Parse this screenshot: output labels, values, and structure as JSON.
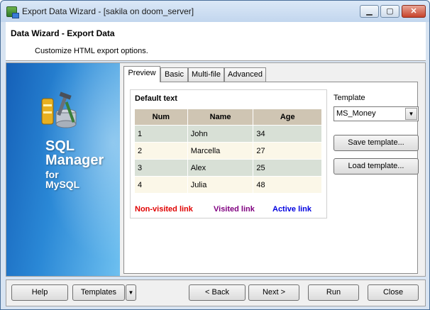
{
  "window": {
    "title": "Export Data Wizard - [sakila on doom_server]",
    "min_symbol": "▁",
    "max_symbol": "▢",
    "close_symbol": "✕"
  },
  "header": {
    "title": "Data Wizard - Export Data",
    "subtitle": "Customize HTML export options."
  },
  "banner": {
    "line1": "SQL",
    "line2": "Manager",
    "line3": "for",
    "line4": "MySQL"
  },
  "tabs": [
    {
      "label": "Preview",
      "active": true
    },
    {
      "label": "Basic",
      "active": false
    },
    {
      "label": "Multi-file",
      "active": false
    },
    {
      "label": "Advanced",
      "active": false
    }
  ],
  "preview": {
    "title": "Default text",
    "columns": [
      "Num",
      "Name",
      "Age"
    ],
    "rows": [
      [
        "1",
        "John",
        "34"
      ],
      [
        "2",
        "Marcella",
        "27"
      ],
      [
        "3",
        "Alex",
        "25"
      ],
      [
        "4",
        "Julia",
        "48"
      ]
    ],
    "links": {
      "non_visited": "Non-visited link",
      "visited": "Visited link",
      "active": "Active link"
    },
    "colors": {
      "non_visited": "#e00000",
      "visited": "#800080",
      "active": "#0000e0"
    }
  },
  "template": {
    "label": "Template",
    "value": "MS_Money",
    "save_button": "Save template...",
    "load_button": "Load template..."
  },
  "footer": {
    "help": "Help",
    "templates": "Templates",
    "back": "< Back",
    "next": "Next >",
    "run": "Run",
    "close": "Close"
  }
}
